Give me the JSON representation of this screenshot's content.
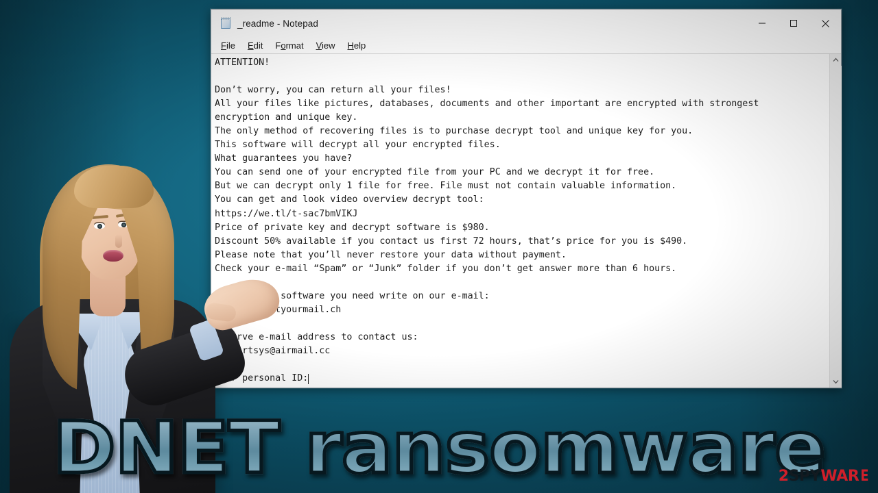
{
  "window": {
    "title": "_readme - Notepad",
    "icon": "notepad-icon",
    "menu": [
      {
        "label": "File",
        "accel": "F"
      },
      {
        "label": "Edit",
        "accel": "E"
      },
      {
        "label": "Format",
        "accel": "o"
      },
      {
        "label": "View",
        "accel": "V"
      },
      {
        "label": "Help",
        "accel": "H"
      }
    ],
    "controls": {
      "minimize": "minimize-button",
      "maximize": "maximize-button",
      "close": "close-button"
    },
    "scrollbar": {
      "up_arrow": "scroll-up-arrow",
      "down_arrow": "scroll-down-arrow"
    }
  },
  "note": {
    "text": "ATTENTION!\n\nDon’t worry, you can return all your files!\nAll your files like pictures, databases, documents and other important are encrypted with strongest\nencryption and unique key.\nThe only method of recovering files is to purchase decrypt tool and unique key for you.\nThis software will decrypt all your encrypted files.\nWhat guarantees you have?\nYou can send one of your encrypted file from your PC and we decrypt it for free.\nBut we can decrypt only 1 file for free. File must not contain valuable information.\nYou can get and look video overview decrypt tool:\nhttps://we.tl/t-sac7bmVIKJ\nPrice of private key and decrypt software is $980.\nDiscount 50% available if you contact us first 72 hours, that’s price for you is $490.\nPlease note that you’ll never restore your data without payment.\nCheck your e-mail “Spam” or “Junk” folder if you don’t get answer more than 6 hours.\n\nTo get this software you need write on our e-mail:\nsupport@bestyourmail.ch\n\nReserve e-mail address to contact us:\nsupportsys@airmail.cc\n\nYour personal ID:",
    "video_url": "https://we.tl/t-sac7bmVIKJ",
    "price_full": "$980",
    "price_discount": "$490",
    "discount_percent": "50%",
    "discount_window_hours": "72 hours",
    "answer_time_hours": "6 hours",
    "email_primary": "support@bestyourmail.ch",
    "email_reserve": "supportsys@airmail.cc",
    "personal_id_label": "Your personal ID:"
  },
  "headline": {
    "text": "DNET ransomware"
  },
  "watermark": {
    "digit": "2",
    "part_dark": "SPY",
    "part_red": "WAR",
    "part_e": "E",
    "full": "2SPYWARE"
  },
  "colors": {
    "background_teal": "#0d566e",
    "headline_fill": "#7ea4b6",
    "headline_outline": "#07181f",
    "watermark_red": "#cf1f2a",
    "watermark_dark": "#121a20",
    "window_bg": "#ffffff"
  }
}
